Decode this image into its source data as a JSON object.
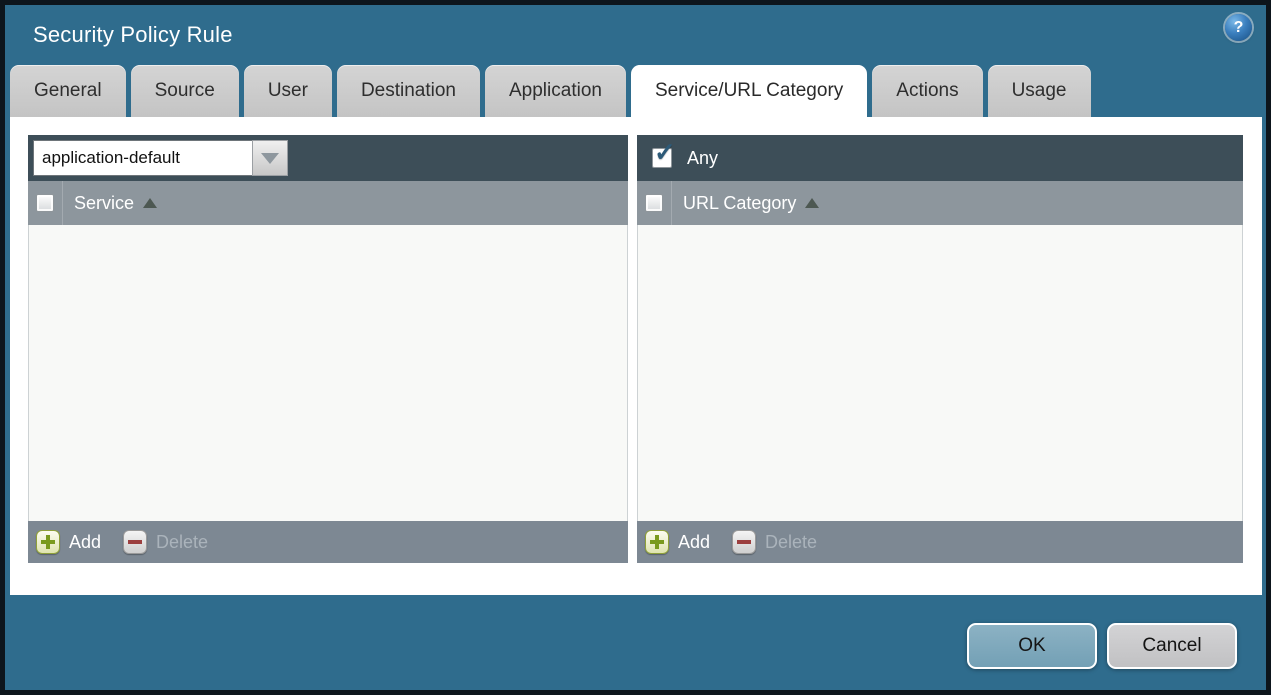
{
  "window": {
    "title": "Security Policy Rule"
  },
  "icons": {
    "help": "?",
    "check": "✓",
    "sort_asc": "sort-ascending-triangle",
    "dropdown": "chevron-down-triangle",
    "add": "green-plus",
    "delete": "red-minus"
  },
  "tabs": [
    {
      "label": "General",
      "active": false
    },
    {
      "label": "Source",
      "active": false
    },
    {
      "label": "User",
      "active": false
    },
    {
      "label": "Destination",
      "active": false
    },
    {
      "label": "Application",
      "active": false
    },
    {
      "label": "Service/URL Category",
      "active": true
    },
    {
      "label": "Actions",
      "active": false
    },
    {
      "label": "Usage",
      "active": false
    }
  ],
  "service_panel": {
    "dropdown_value": "application-default",
    "column_header": "Service",
    "rows": [],
    "add_label": "Add",
    "delete_label": "Delete",
    "delete_disabled": true
  },
  "url_category_panel": {
    "any_label": "Any",
    "any_checked": true,
    "column_header": "URL Category",
    "rows": [],
    "add_label": "Add",
    "delete_label": "Delete",
    "delete_disabled": true
  },
  "dialog_buttons": {
    "ok": "OK",
    "cancel": "Cancel"
  },
  "colors": {
    "background_teal": "#2f6c8d",
    "window_border": "#0d151c",
    "panel_header_dark": "#3d4e58",
    "column_header_gray": "#8d969d",
    "footer_bar_gray": "#7d8893",
    "list_body": "#f8f9f7",
    "tab_inactive": "#c9c9c9",
    "tab_active": "#ffffff",
    "ok_button": "#7fa9bc",
    "cancel_button": "#c9cacc",
    "add_icon_green": "#7a9a1e",
    "delete_icon_red": "#9c3f3f",
    "check_blue": "#2d5a78"
  }
}
